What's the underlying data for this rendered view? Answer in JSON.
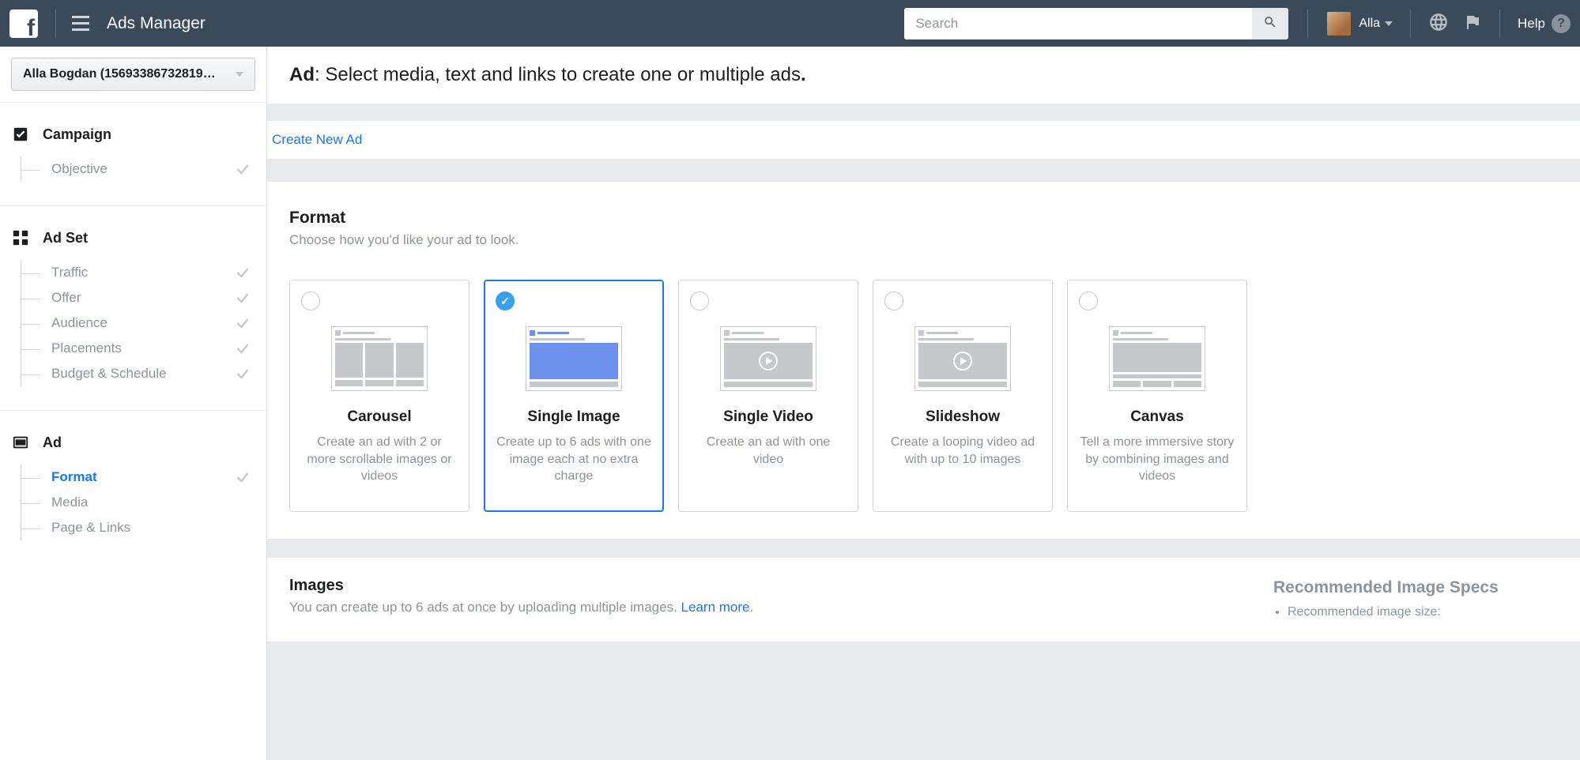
{
  "top_nav": {
    "app_title": "Ads Manager",
    "search_placeholder": "Search",
    "user_name": "Alla",
    "help_label": "Help"
  },
  "sidebar": {
    "account_selector": "Alla Bogdan (15693386732819…",
    "campaign": {
      "label": "Campaign",
      "items": [
        {
          "label": "Objective"
        }
      ]
    },
    "adset": {
      "label": "Ad Set",
      "items": [
        {
          "label": "Traffic"
        },
        {
          "label": "Offer"
        },
        {
          "label": "Audience"
        },
        {
          "label": "Placements"
        },
        {
          "label": "Budget & Schedule"
        }
      ]
    },
    "ad": {
      "label": "Ad",
      "items": [
        {
          "label": "Format",
          "active": true
        },
        {
          "label": "Media"
        },
        {
          "label": "Page & Links"
        }
      ]
    }
  },
  "main": {
    "ad_head_bold": "Ad",
    "ad_head_rest": ": Select media, text and links to create one or multiple ads",
    "ad_head_end": ".",
    "create_tab": "Create New Ad",
    "format": {
      "title": "Format",
      "subtitle": "Choose how you'd like your ad to look.",
      "options": [
        {
          "title": "Carousel",
          "desc": "Create an ad with 2 or more scrollable images or videos"
        },
        {
          "title": "Single Image",
          "desc": "Create up to 6 ads with one image each at no extra charge"
        },
        {
          "title": "Single Video",
          "desc": "Create an ad with one video"
        },
        {
          "title": "Slideshow",
          "desc": "Create a looping video ad with up to 10 images"
        },
        {
          "title": "Canvas",
          "desc": "Tell a more immersive story by combining images and videos"
        }
      ]
    },
    "images": {
      "title": "Images",
      "desc_before": "You can create up to 6 ads at once by uploading multiple images. ",
      "learn_more": "Learn more",
      "desc_after": ".",
      "specs_title": "Recommended Image Specs",
      "specs": [
        "Recommended image size:"
      ]
    }
  }
}
